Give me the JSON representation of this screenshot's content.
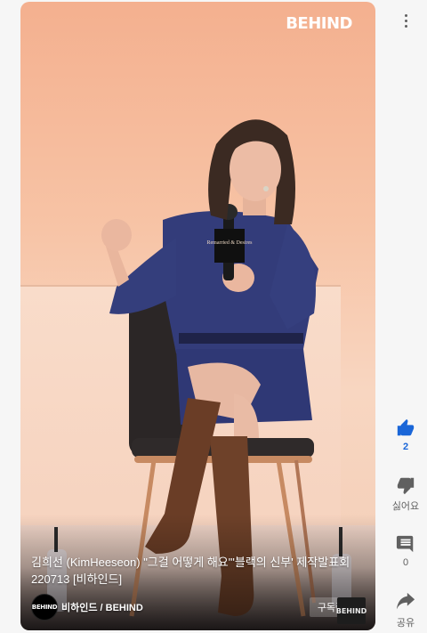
{
  "video": {
    "watermark": "BEHIND",
    "caption": "김희선 (KimHeeseon) \"그걸 어떻게 해요\"'블랙의 신부' 제작발표회 220713 [비하인드]",
    "channel": {
      "avatar_text": "BEHIND",
      "name": "비하인드 / BEHIND",
      "subscribe_label": "구독중",
      "corner_logo": "BEHIND"
    },
    "mic_flag_text": "Remarried & Desires"
  },
  "rail": {
    "more_icon": "more-vertical-icon",
    "like": {
      "icon": "thumbs-up-icon",
      "label": "2",
      "color": "#1a66d8"
    },
    "dislike": {
      "icon": "thumbs-down-icon",
      "label": "싫어요"
    },
    "comments": {
      "icon": "comment-icon",
      "label": "0"
    },
    "share": {
      "icon": "share-icon",
      "label": "공유"
    }
  }
}
